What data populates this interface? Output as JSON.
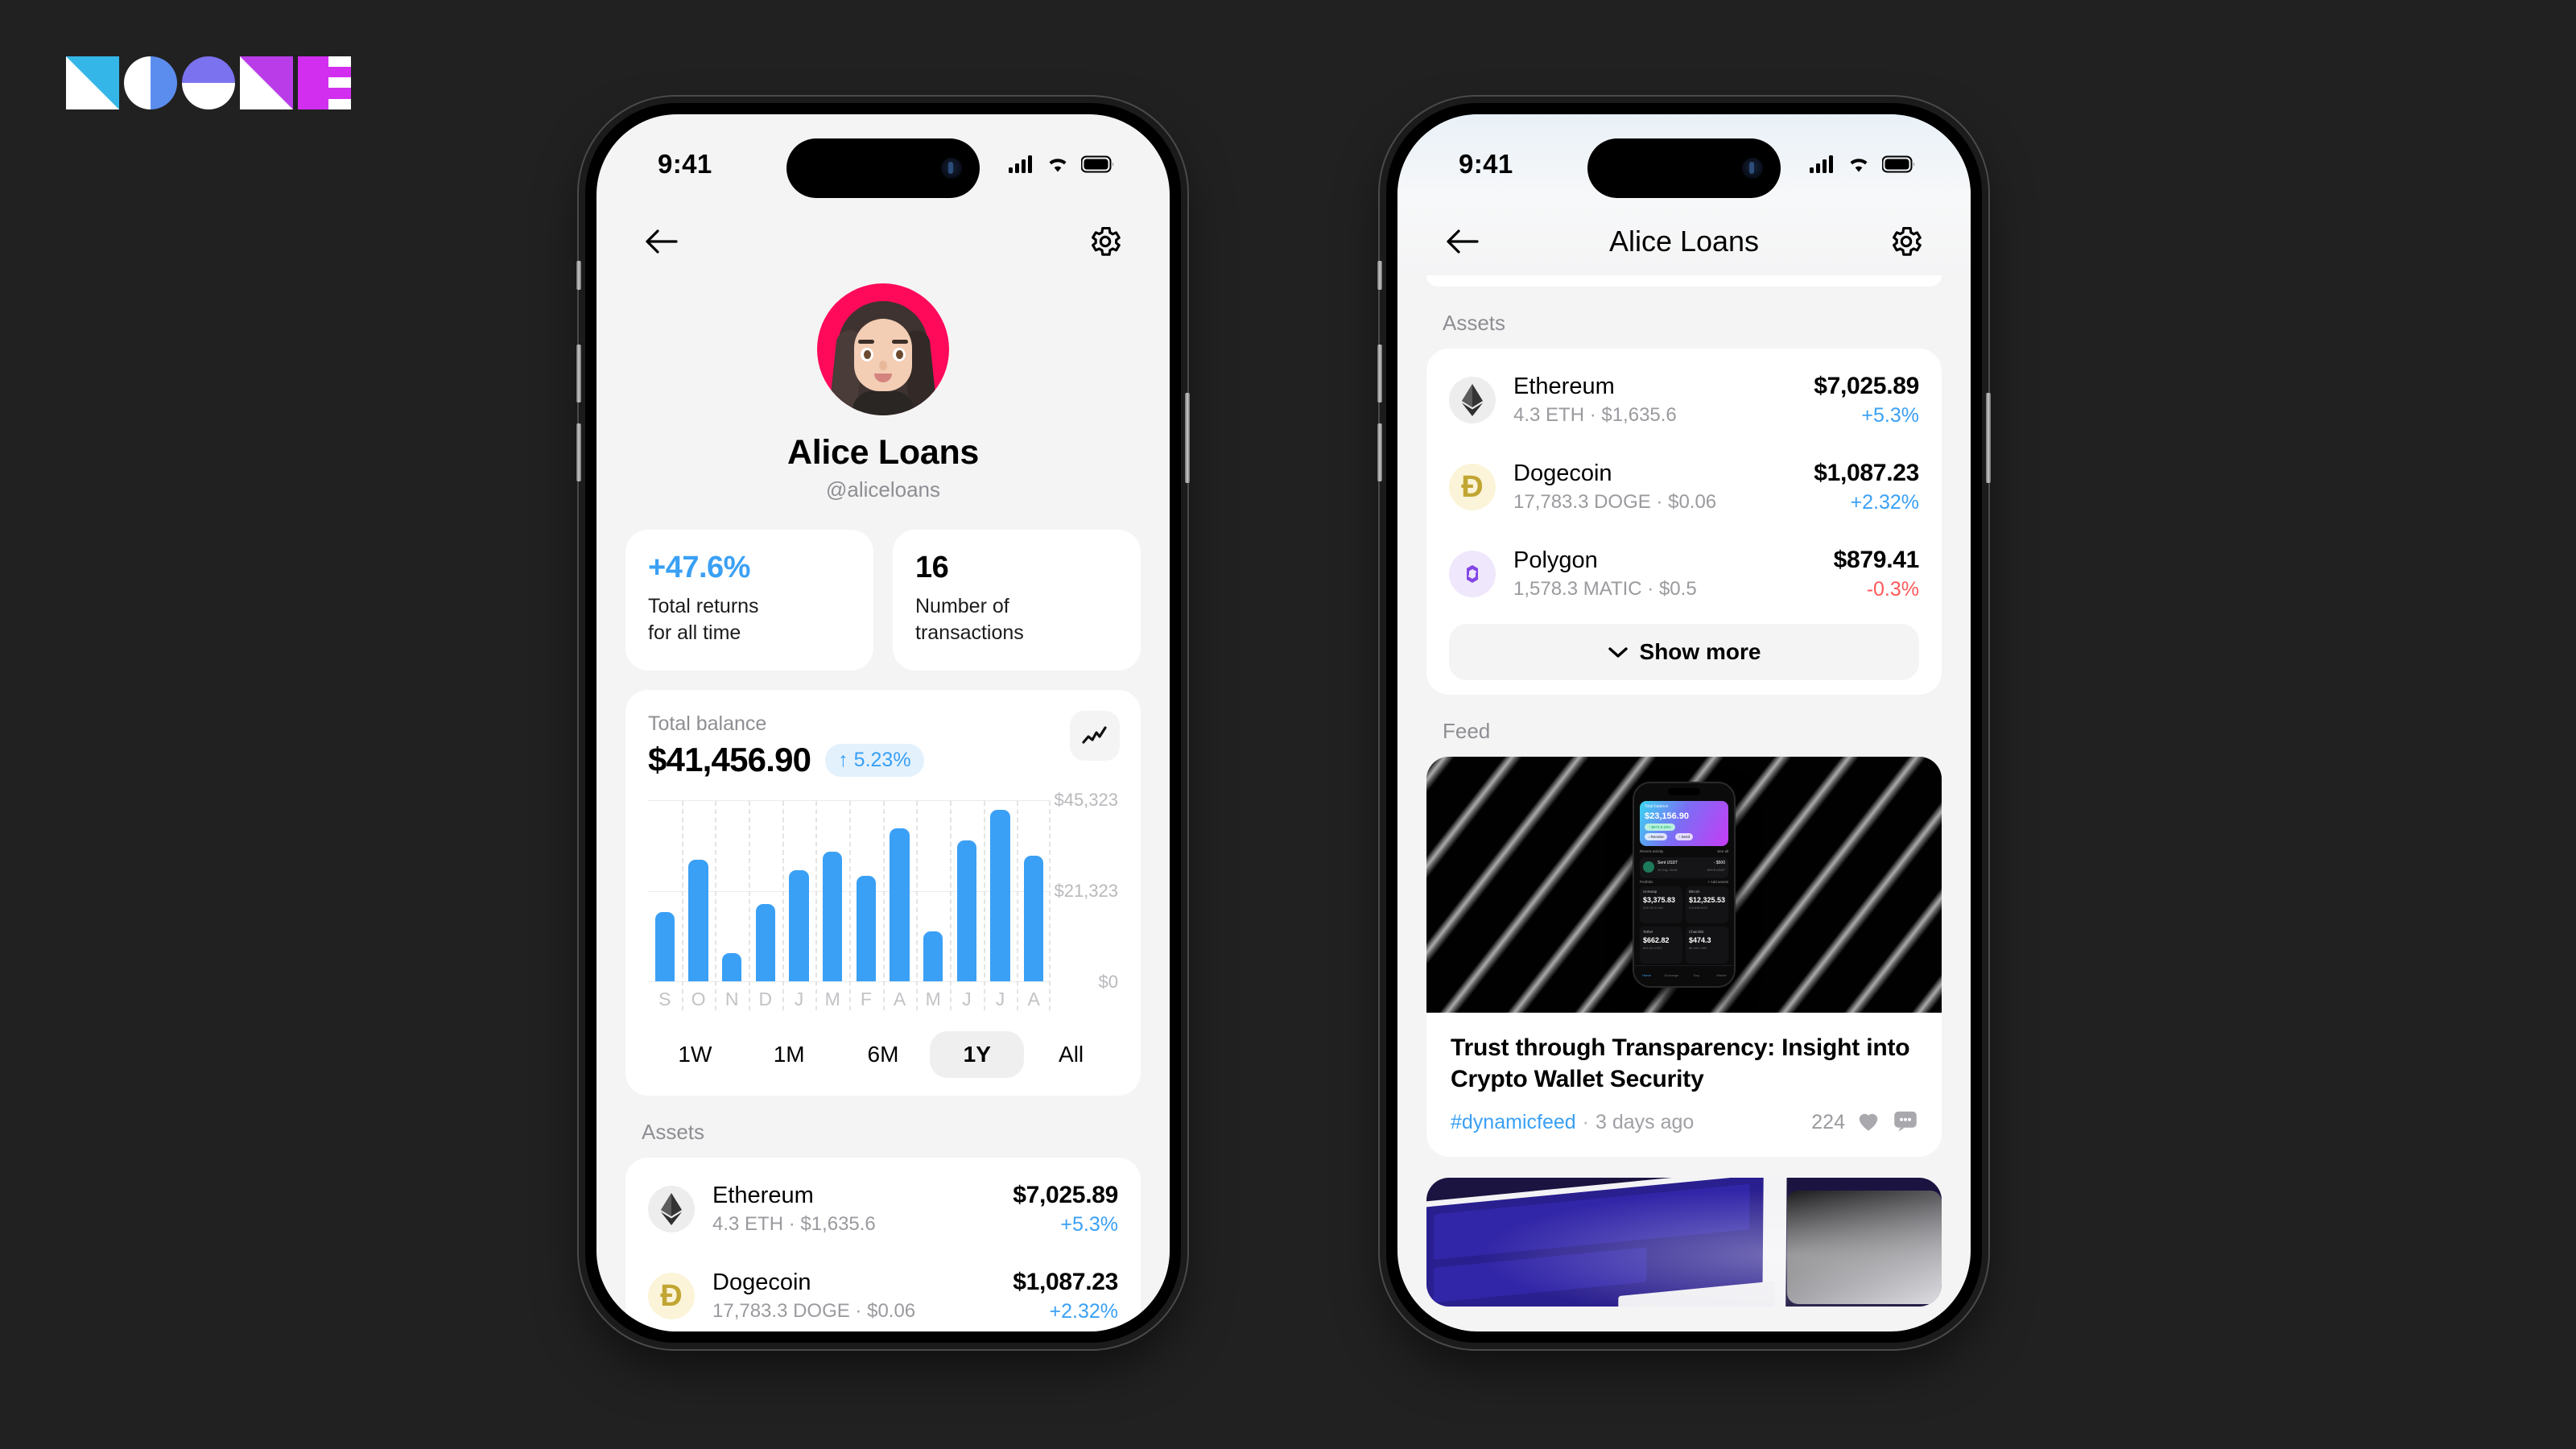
{
  "brand": {
    "name": "NOONE",
    "letters": [
      "N",
      "O",
      "O",
      "N",
      "E"
    ],
    "colors": {
      "n1": "#35b6e8",
      "o1": "#5b8def",
      "o2": "#7b72ef",
      "n2": "#b93ce8",
      "e": "#d22ef0"
    }
  },
  "accent": {
    "blue": "#3aa0f5",
    "red": "#ff5a5a",
    "pink": "#ff0a5a"
  },
  "phone1": {
    "status": {
      "time": "9:41",
      "cellular": "signal-bars",
      "wifi": "wifi",
      "battery": "battery-full"
    },
    "header": {
      "back": "back-arrow",
      "settings": "gear"
    },
    "profile": {
      "name": "Alice Loans",
      "handle": "@aliceloans"
    },
    "stats": [
      {
        "value": "+47.6%",
        "label": "Total returns\nfor all time",
        "label_line1": "Total returns",
        "label_line2": "for all time",
        "tone": "blue"
      },
      {
        "value": "16",
        "label_line1": "Number of",
        "label_line2": "transactions",
        "tone": "black"
      }
    ],
    "balance": {
      "label": "Total balance",
      "amount": "$41,456.90",
      "change": "↑ 5.23%",
      "toggle_icon": "line-chart-icon"
    },
    "ranges": [
      {
        "label": "1W",
        "active": false
      },
      {
        "label": "1M",
        "active": false
      },
      {
        "label": "6M",
        "active": false
      },
      {
        "label": "1Y",
        "active": true
      },
      {
        "label": "All",
        "active": false
      }
    ],
    "assets_title": "Assets",
    "assets": [
      {
        "name": "Ethereum",
        "sub": "4.3 ETH · $1,635.6",
        "amount": "$7,025.89",
        "change": "+5.3%",
        "dir": "up",
        "icon": "ethereum-icon"
      },
      {
        "name": "Dogecoin",
        "sub": "17,783.3 DOGE · $0.06",
        "amount": "$1,087.23",
        "change": "+2.32%",
        "dir": "up",
        "icon": "dogecoin-icon"
      }
    ]
  },
  "phone2": {
    "status": {
      "time": "9:41"
    },
    "header": {
      "title": "Alice Loans",
      "back": "back-arrow",
      "settings": "gear"
    },
    "assets_title": "Assets",
    "assets": [
      {
        "name": "Ethereum",
        "sub": "4.3 ETH · $1,635.6",
        "amount": "$7,025.89",
        "change": "+5.3%",
        "dir": "up",
        "icon": "ethereum-icon"
      },
      {
        "name": "Dogecoin",
        "sub": "17,783.3 DOGE · $0.06",
        "amount": "$1,087.23",
        "change": "+2.32%",
        "dir": "up",
        "icon": "dogecoin-icon"
      },
      {
        "name": "Polygon",
        "sub": "1,578.3 MATIC · $0.5",
        "amount": "$879.41",
        "change": "-0.3%",
        "dir": "down",
        "icon": "polygon-icon"
      }
    ],
    "show_more": "Show more",
    "feed_title": "Feed",
    "feed": [
      {
        "title": "Trust through Transparency: Insight into Crypto Wallet Security",
        "tag": "#dynamicfeed",
        "separator": "·",
        "time": "3 days ago",
        "likes": "224",
        "like_icon": "heart-icon",
        "comment_icon": "comment-icon",
        "preview": {
          "balance_label": "Total balance",
          "balance_value": "$23,156.90",
          "balance_chip": "↑ $873  5.23%",
          "btn_receive": "↓ Receive",
          "btn_send": "↑ Send",
          "activity_label": "Recent activity",
          "activity_link": "See all",
          "activity_item": "Sent USDT",
          "activity_sub": "10 July, 16:34",
          "activity_amt": "- $500",
          "activity_amt_sub": "- 500.8 USDT",
          "portfolio_label": "Portfolio",
          "portfolio_add": "+ Add assets",
          "tiles": [
            {
              "name": "Uniswap",
              "value": "$3,375.83",
              "sub": "518.7878 UNI"
            },
            {
              "name": "Bitcoin",
              "value": "$12,325.53",
              "sub": "0.54169 BTC"
            },
            {
              "name": "Tether",
              "value": "$662.82",
              "sub": "662.94 USDT"
            },
            {
              "name": "Chainlink",
              "value": "$474.3",
              "sub": "68.409 LINK"
            }
          ],
          "tabs": [
            "Home",
            "Exchange",
            "Buy",
            "Market"
          ]
        }
      },
      {
        "title": "",
        "image_only": true
      }
    ]
  },
  "chart_data": {
    "type": "bar",
    "title": "Total balance",
    "categories": [
      "S",
      "O",
      "N",
      "D",
      "J",
      "M",
      "F",
      "A",
      "M",
      "J",
      "J",
      "A"
    ],
    "values": [
      17500,
      30500,
      7000,
      19500,
      28000,
      32500,
      26500,
      38500,
      12500,
      35500,
      43000,
      31500
    ],
    "ylabels": [
      "$0",
      "$21,323",
      "$45,323"
    ],
    "ylim": [
      0,
      45323
    ],
    "ytick_values": [
      0,
      21323,
      45323
    ],
    "xlabel": "",
    "ylabel": "",
    "grid": true,
    "series_color": "#3aa0f5",
    "legend": "none",
    "range_selected": "1Y"
  }
}
